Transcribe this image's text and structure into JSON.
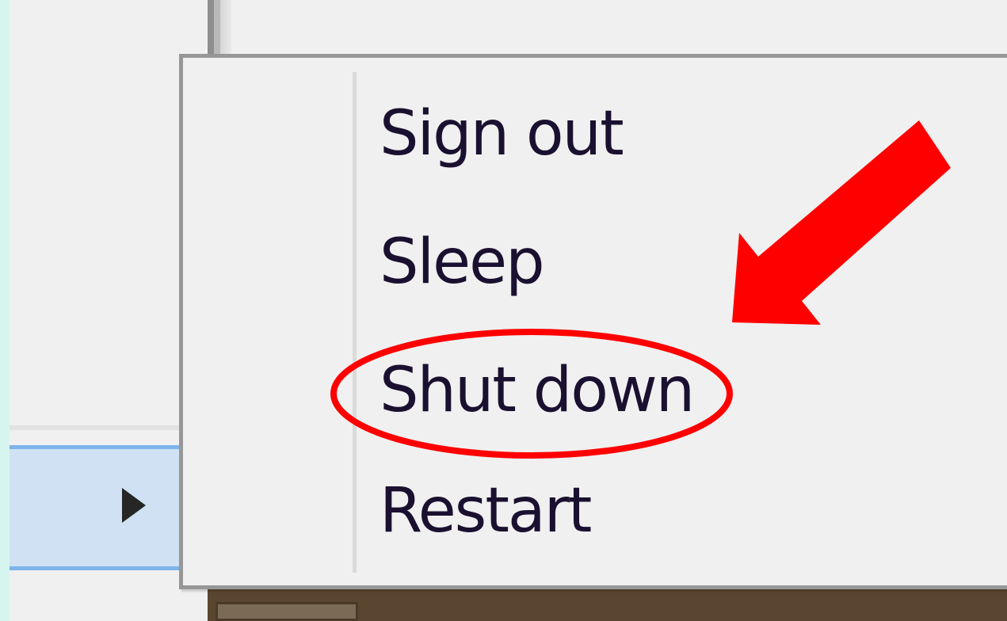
{
  "power_menu": {
    "items": [
      {
        "label": "Sign out"
      },
      {
        "label": "Sleep"
      },
      {
        "label": "Shut down"
      },
      {
        "label": "Restart"
      }
    ],
    "highlighted_item": "Shut down"
  },
  "annotation": {
    "color": "#ff0000"
  }
}
